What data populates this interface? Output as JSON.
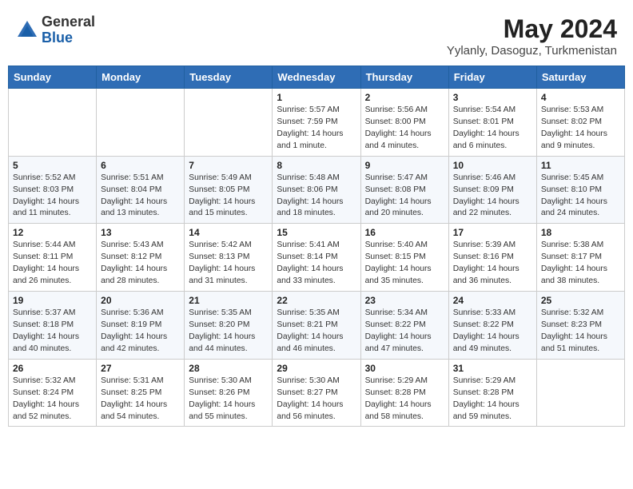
{
  "logo": {
    "general": "General",
    "blue": "Blue"
  },
  "title": "May 2024",
  "location": "Yylanly, Dasoguz, Turkmenistan",
  "days_of_week": [
    "Sunday",
    "Monday",
    "Tuesday",
    "Wednesday",
    "Thursday",
    "Friday",
    "Saturday"
  ],
  "weeks": [
    [
      {
        "day": "",
        "info": ""
      },
      {
        "day": "",
        "info": ""
      },
      {
        "day": "",
        "info": ""
      },
      {
        "day": "1",
        "info": "Sunrise: 5:57 AM\nSunset: 7:59 PM\nDaylight: 14 hours\nand 1 minute."
      },
      {
        "day": "2",
        "info": "Sunrise: 5:56 AM\nSunset: 8:00 PM\nDaylight: 14 hours\nand 4 minutes."
      },
      {
        "day": "3",
        "info": "Sunrise: 5:54 AM\nSunset: 8:01 PM\nDaylight: 14 hours\nand 6 minutes."
      },
      {
        "day": "4",
        "info": "Sunrise: 5:53 AM\nSunset: 8:02 PM\nDaylight: 14 hours\nand 9 minutes."
      }
    ],
    [
      {
        "day": "5",
        "info": "Sunrise: 5:52 AM\nSunset: 8:03 PM\nDaylight: 14 hours\nand 11 minutes."
      },
      {
        "day": "6",
        "info": "Sunrise: 5:51 AM\nSunset: 8:04 PM\nDaylight: 14 hours\nand 13 minutes."
      },
      {
        "day": "7",
        "info": "Sunrise: 5:49 AM\nSunset: 8:05 PM\nDaylight: 14 hours\nand 15 minutes."
      },
      {
        "day": "8",
        "info": "Sunrise: 5:48 AM\nSunset: 8:06 PM\nDaylight: 14 hours\nand 18 minutes."
      },
      {
        "day": "9",
        "info": "Sunrise: 5:47 AM\nSunset: 8:08 PM\nDaylight: 14 hours\nand 20 minutes."
      },
      {
        "day": "10",
        "info": "Sunrise: 5:46 AM\nSunset: 8:09 PM\nDaylight: 14 hours\nand 22 minutes."
      },
      {
        "day": "11",
        "info": "Sunrise: 5:45 AM\nSunset: 8:10 PM\nDaylight: 14 hours\nand 24 minutes."
      }
    ],
    [
      {
        "day": "12",
        "info": "Sunrise: 5:44 AM\nSunset: 8:11 PM\nDaylight: 14 hours\nand 26 minutes."
      },
      {
        "day": "13",
        "info": "Sunrise: 5:43 AM\nSunset: 8:12 PM\nDaylight: 14 hours\nand 28 minutes."
      },
      {
        "day": "14",
        "info": "Sunrise: 5:42 AM\nSunset: 8:13 PM\nDaylight: 14 hours\nand 31 minutes."
      },
      {
        "day": "15",
        "info": "Sunrise: 5:41 AM\nSunset: 8:14 PM\nDaylight: 14 hours\nand 33 minutes."
      },
      {
        "day": "16",
        "info": "Sunrise: 5:40 AM\nSunset: 8:15 PM\nDaylight: 14 hours\nand 35 minutes."
      },
      {
        "day": "17",
        "info": "Sunrise: 5:39 AM\nSunset: 8:16 PM\nDaylight: 14 hours\nand 36 minutes."
      },
      {
        "day": "18",
        "info": "Sunrise: 5:38 AM\nSunset: 8:17 PM\nDaylight: 14 hours\nand 38 minutes."
      }
    ],
    [
      {
        "day": "19",
        "info": "Sunrise: 5:37 AM\nSunset: 8:18 PM\nDaylight: 14 hours\nand 40 minutes."
      },
      {
        "day": "20",
        "info": "Sunrise: 5:36 AM\nSunset: 8:19 PM\nDaylight: 14 hours\nand 42 minutes."
      },
      {
        "day": "21",
        "info": "Sunrise: 5:35 AM\nSunset: 8:20 PM\nDaylight: 14 hours\nand 44 minutes."
      },
      {
        "day": "22",
        "info": "Sunrise: 5:35 AM\nSunset: 8:21 PM\nDaylight: 14 hours\nand 46 minutes."
      },
      {
        "day": "23",
        "info": "Sunrise: 5:34 AM\nSunset: 8:22 PM\nDaylight: 14 hours\nand 47 minutes."
      },
      {
        "day": "24",
        "info": "Sunrise: 5:33 AM\nSunset: 8:22 PM\nDaylight: 14 hours\nand 49 minutes."
      },
      {
        "day": "25",
        "info": "Sunrise: 5:32 AM\nSunset: 8:23 PM\nDaylight: 14 hours\nand 51 minutes."
      }
    ],
    [
      {
        "day": "26",
        "info": "Sunrise: 5:32 AM\nSunset: 8:24 PM\nDaylight: 14 hours\nand 52 minutes."
      },
      {
        "day": "27",
        "info": "Sunrise: 5:31 AM\nSunset: 8:25 PM\nDaylight: 14 hours\nand 54 minutes."
      },
      {
        "day": "28",
        "info": "Sunrise: 5:30 AM\nSunset: 8:26 PM\nDaylight: 14 hours\nand 55 minutes."
      },
      {
        "day": "29",
        "info": "Sunrise: 5:30 AM\nSunset: 8:27 PM\nDaylight: 14 hours\nand 56 minutes."
      },
      {
        "day": "30",
        "info": "Sunrise: 5:29 AM\nSunset: 8:28 PM\nDaylight: 14 hours\nand 58 minutes."
      },
      {
        "day": "31",
        "info": "Sunrise: 5:29 AM\nSunset: 8:28 PM\nDaylight: 14 hours\nand 59 minutes."
      },
      {
        "day": "",
        "info": ""
      }
    ]
  ]
}
